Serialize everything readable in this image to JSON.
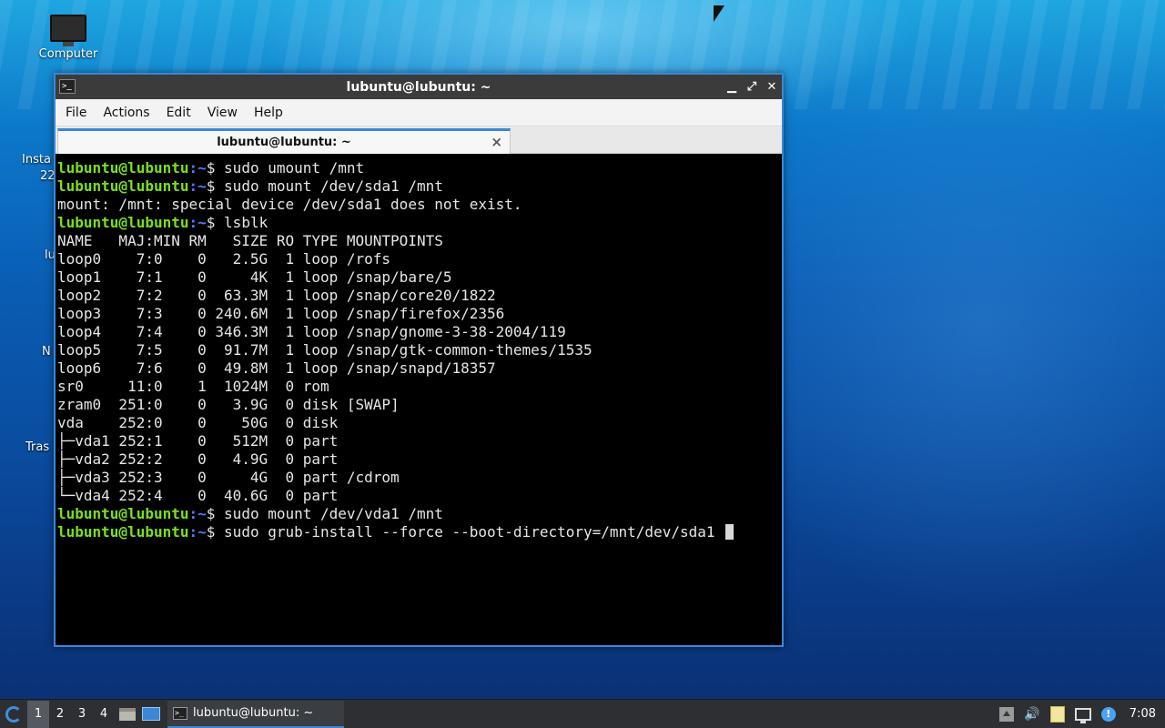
{
  "desktop": {
    "computer_label": "Computer",
    "partial_labels": [
      "Insta",
      "22",
      "lu",
      "N",
      "Tras"
    ]
  },
  "window": {
    "title": "lubuntu@lubuntu: ~",
    "menu": [
      "File",
      "Actions",
      "Edit",
      "View",
      "Help"
    ],
    "tab_title": "lubuntu@lubuntu: ~",
    "buttons": {
      "minimize": "▁",
      "maximize": "⤢",
      "close": "✕"
    }
  },
  "terminal": {
    "prompt_user": "lubuntu@lubuntu",
    "prompt_tail": "~",
    "lines": [
      {
        "type": "cmd",
        "text": "sudo umount /mnt"
      },
      {
        "type": "cmd",
        "text": "sudo mount /dev/sda1 /mnt"
      },
      {
        "type": "out",
        "text": "mount: /mnt: special device /dev/sda1 does not exist."
      },
      {
        "type": "cmd",
        "text": "lsblk"
      },
      {
        "type": "out",
        "text": "NAME   MAJ:MIN RM   SIZE RO TYPE MOUNTPOINTS"
      },
      {
        "type": "out",
        "text": "loop0    7:0    0   2.5G  1 loop /rofs"
      },
      {
        "type": "out",
        "text": "loop1    7:1    0     4K  1 loop /snap/bare/5"
      },
      {
        "type": "out",
        "text": "loop2    7:2    0  63.3M  1 loop /snap/core20/1822"
      },
      {
        "type": "out",
        "text": "loop3    7:3    0 240.6M  1 loop /snap/firefox/2356"
      },
      {
        "type": "out",
        "text": "loop4    7:4    0 346.3M  1 loop /snap/gnome-3-38-2004/119"
      },
      {
        "type": "out",
        "text": "loop5    7:5    0  91.7M  1 loop /snap/gtk-common-themes/1535"
      },
      {
        "type": "out",
        "text": "loop6    7:6    0  49.8M  1 loop /snap/snapd/18357"
      },
      {
        "type": "out",
        "text": "sr0     11:0    1  1024M  0 rom"
      },
      {
        "type": "out",
        "text": "zram0  251:0    0   3.9G  0 disk [SWAP]"
      },
      {
        "type": "out",
        "text": "vda    252:0    0    50G  0 disk"
      },
      {
        "type": "out",
        "text": "├─vda1 252:1    0   512M  0 part"
      },
      {
        "type": "out",
        "text": "├─vda2 252:2    0   4.9G  0 part"
      },
      {
        "type": "out",
        "text": "├─vda3 252:3    0     4G  0 part /cdrom"
      },
      {
        "type": "out",
        "text": "└─vda4 252:4    0  40.6G  0 part"
      },
      {
        "type": "cmd",
        "text": "sudo mount /dev/vda1 /mnt"
      },
      {
        "type": "cmd",
        "text": "sudo grub-install --force --boot-directory=/mnt/dev/sda1 ",
        "cursor": true
      }
    ]
  },
  "taskbar": {
    "workspaces": [
      "1",
      "2",
      "3",
      "4"
    ],
    "active_workspace": "1",
    "task_label": "lubuntu@lubuntu: ~",
    "clock": "7:08",
    "update_badge": "!"
  },
  "colors": {
    "prompt_user": "#7be01a",
    "prompt_path": "#5878ff",
    "accent": "#3b87d6"
  }
}
